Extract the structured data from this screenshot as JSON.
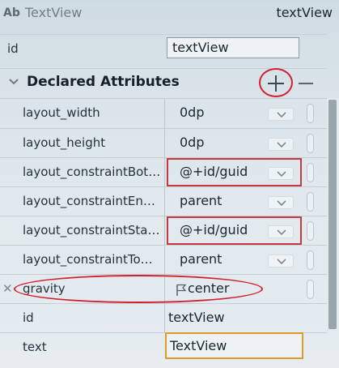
{
  "header": {
    "icon_text": "Ab",
    "component_type": "TextView",
    "component_id": "textView"
  },
  "id_row": {
    "label": "id",
    "value": "textView"
  },
  "section": {
    "title": "Declared Attributes"
  },
  "attributes": [
    {
      "label": "layout_width",
      "value": "0dp"
    },
    {
      "label": "layout_height",
      "value": "0dp"
    },
    {
      "label": "layout_constraintBot…",
      "value": "@+id/guid"
    },
    {
      "label": "layout_constraintEn…",
      "value": "parent"
    },
    {
      "label": "layout_constraintSta…",
      "value": "@+id/guid"
    },
    {
      "label": "layout_constraintTo…",
      "value": "parent"
    }
  ],
  "gravity": {
    "label": "gravity",
    "value": "center"
  },
  "id_attr": {
    "label": "id",
    "value": "textView"
  },
  "text_attr": {
    "label": "text",
    "value": "TextView"
  },
  "colors": {
    "highlight_red": "#c8383f",
    "focus_orange": "#e09a26"
  }
}
